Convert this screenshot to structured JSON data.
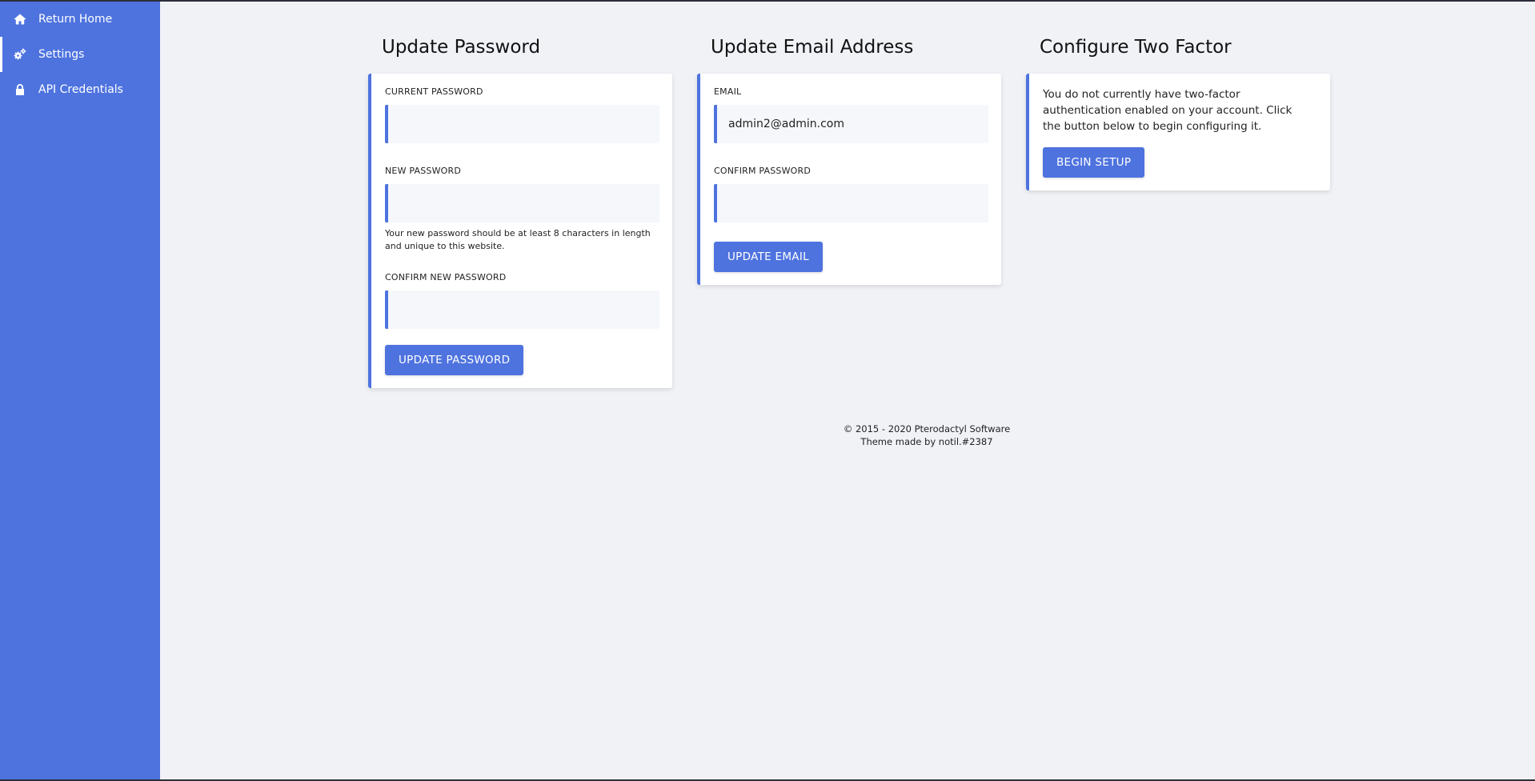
{
  "sidebar": {
    "items": [
      {
        "label": "Return Home",
        "icon": "home-icon"
      },
      {
        "label": "Settings",
        "icon": "cogs-icon",
        "active": true
      },
      {
        "label": "API Credentials",
        "icon": "lock-icon"
      }
    ]
  },
  "password": {
    "title": "Update Password",
    "current_label": "CURRENT PASSWORD",
    "current_value": "",
    "new_label": "NEW PASSWORD",
    "new_value": "",
    "new_help": "Your new password should be at least 8 characters in length and unique to this website.",
    "confirm_label": "CONFIRM NEW PASSWORD",
    "confirm_value": "",
    "button": "UPDATE PASSWORD"
  },
  "email": {
    "title": "Update Email Address",
    "email_label": "EMAIL",
    "email_value": "admin2@admin.com",
    "confirm_label": "CONFIRM PASSWORD",
    "confirm_value": "",
    "button": "UPDATE EMAIL"
  },
  "two_factor": {
    "title": "Configure Two Factor",
    "text": "You do not currently have two-factor authentication enabled on your account. Click the button below to begin configuring it.",
    "button": "BEGIN SETUP"
  },
  "footer": {
    "copyright": "© 2015 - 2020 Pterodactyl Software",
    "theme": "Theme made by notil.#2387"
  },
  "colors": {
    "accent": "#4e73df",
    "background": "#f0f2f6",
    "card": "#ffffff",
    "input_bg": "#f5f7fa"
  }
}
